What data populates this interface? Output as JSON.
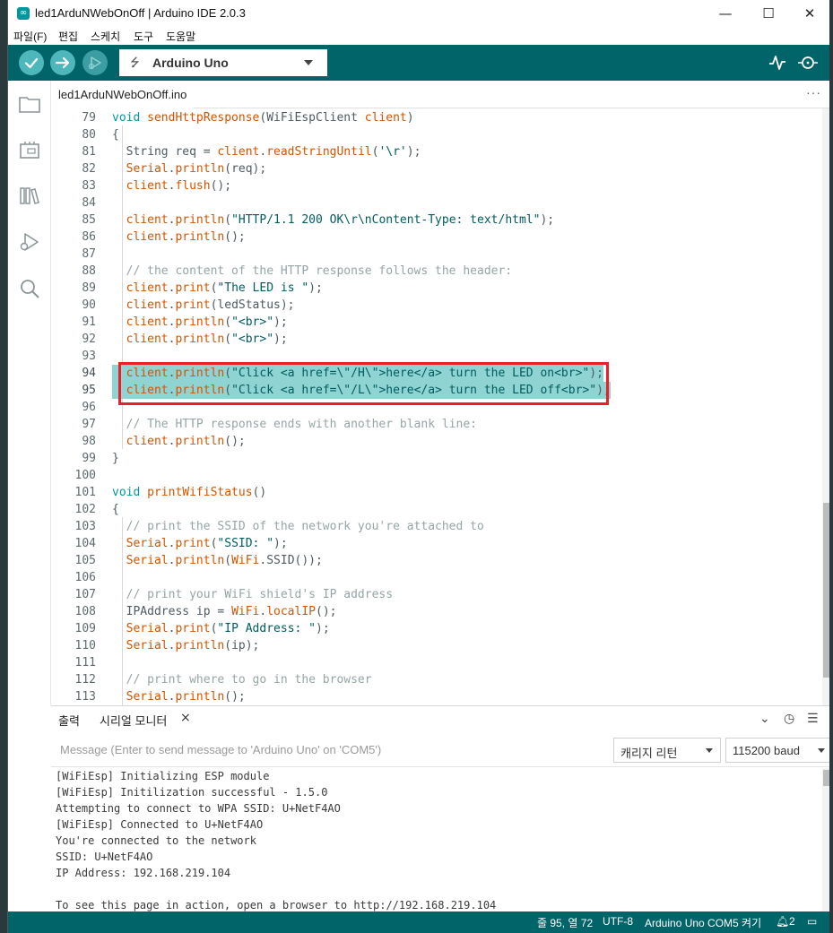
{
  "window": {
    "title": "led1ArduNWebOnOff | Arduino IDE 2.0.3",
    "controls": {
      "minimize": "—",
      "maximize": "☐",
      "close": "✕"
    }
  },
  "menu": [
    "파일(F)",
    "편집",
    "스케치",
    "도구",
    "도움말"
  ],
  "toolbar": {
    "board": "Arduino Uno",
    "buttons": [
      "verify",
      "upload",
      "debug"
    ],
    "right_icons": [
      "serial-plotter",
      "serial-monitor"
    ]
  },
  "sidebar": {
    "icons": [
      "sketchbook",
      "boards-manager",
      "library-manager",
      "debug",
      "search"
    ]
  },
  "tabs": {
    "file": "led1ArduNWebOnOff.ino",
    "more": "···"
  },
  "editor": {
    "lines": [
      {
        "n": "79",
        "text": "void sendHttpResponse(WiFiEspClient client)"
      },
      {
        "n": "80",
        "text": "{"
      },
      {
        "n": "81",
        "text": "  String req = client.readStringUntil('\\r');"
      },
      {
        "n": "82",
        "text": "  Serial.println(req);"
      },
      {
        "n": "83",
        "text": "  client.flush();"
      },
      {
        "n": "84",
        "text": ""
      },
      {
        "n": "85",
        "text": "  client.println(\"HTTP/1.1 200 OK\\r\\nContent-Type: text/html\");"
      },
      {
        "n": "86",
        "text": "  client.println();"
      },
      {
        "n": "87",
        "text": ""
      },
      {
        "n": "88",
        "text": "  // the content of the HTTP response follows the header:"
      },
      {
        "n": "89",
        "text": "  client.print(\"The LED is \");"
      },
      {
        "n": "90",
        "text": "  client.print(ledStatus);"
      },
      {
        "n": "91",
        "text": "  client.println(\"<br>\");"
      },
      {
        "n": "92",
        "text": "  client.println(\"<br>\");"
      },
      {
        "n": "93",
        "text": ""
      },
      {
        "n": "94",
        "text": "  client.println(\"Click <a href=\\\"/H\\\">here</a> turn the LED on<br>\");",
        "hl": true
      },
      {
        "n": "95",
        "text": "  client.println(\"Click <a href=\\\"/L\\\">here</a> turn the LED off<br>\");",
        "hl": true
      },
      {
        "n": "96",
        "text": ""
      },
      {
        "n": "97",
        "text": "  // The HTTP response ends with another blank line:"
      },
      {
        "n": "98",
        "text": "  client.println();"
      },
      {
        "n": "99",
        "text": "}"
      },
      {
        "n": "100",
        "text": ""
      },
      {
        "n": "101",
        "text": "void printWifiStatus()"
      },
      {
        "n": "102",
        "text": "{"
      },
      {
        "n": "103",
        "text": "  // print the SSID of the network you're attached to"
      },
      {
        "n": "104",
        "text": "  Serial.print(\"SSID: \");"
      },
      {
        "n": "105",
        "text": "  Serial.println(WiFi.SSID());"
      },
      {
        "n": "106",
        "text": ""
      },
      {
        "n": "107",
        "text": "  // print your WiFi shield's IP address"
      },
      {
        "n": "108",
        "text": "  IPAddress ip = WiFi.localIP();"
      },
      {
        "n": "109",
        "text": "  Serial.print(\"IP Address: \");"
      },
      {
        "n": "110",
        "text": "  Serial.println(ip);"
      },
      {
        "n": "111",
        "text": ""
      },
      {
        "n": "112",
        "text": "  // print where to go in the browser"
      },
      {
        "n": "113",
        "text": "  Serial.println();"
      }
    ]
  },
  "panel": {
    "tab_output": "출력",
    "tab_serial": "시리얼 모니터",
    "tab_close": "×",
    "icons": [
      "collapse-icon",
      "timestamp-icon",
      "clear-output-icon"
    ],
    "message_placeholder": "Message (Enter to send message to 'Arduino Uno' on 'COM5')",
    "line_ending": "캐리지 리턴",
    "baud": "115200 baud",
    "output_lines": [
      "[WiFiEsp] Initializing ESP module",
      "[WiFiEsp] Initilization successful - 1.5.0",
      "Attempting to connect to WPA SSID: U+NetF4AO",
      "[WiFiEsp] Connected to U+NetF4AO",
      "You're connected to the network",
      "SSID: U+NetF4AO",
      "IP Address: 192.168.219.104",
      "",
      "To see this page in action, open a browser to http://192.168.219.104"
    ]
  },
  "status": {
    "position": "줄 95, 열 72",
    "encoding": "UTF-8",
    "board_port": "Arduino Uno COM5 켜기",
    "notifications": "2"
  },
  "colors": {
    "teal_dark": "#006468",
    "teal_button": "#4db7bb",
    "keyword": "#00979c",
    "function": "#d35400",
    "string": "#005c5f",
    "comment": "#95a5a6",
    "highlight": "#8fd3d3",
    "selection_box": "#e8202a"
  }
}
